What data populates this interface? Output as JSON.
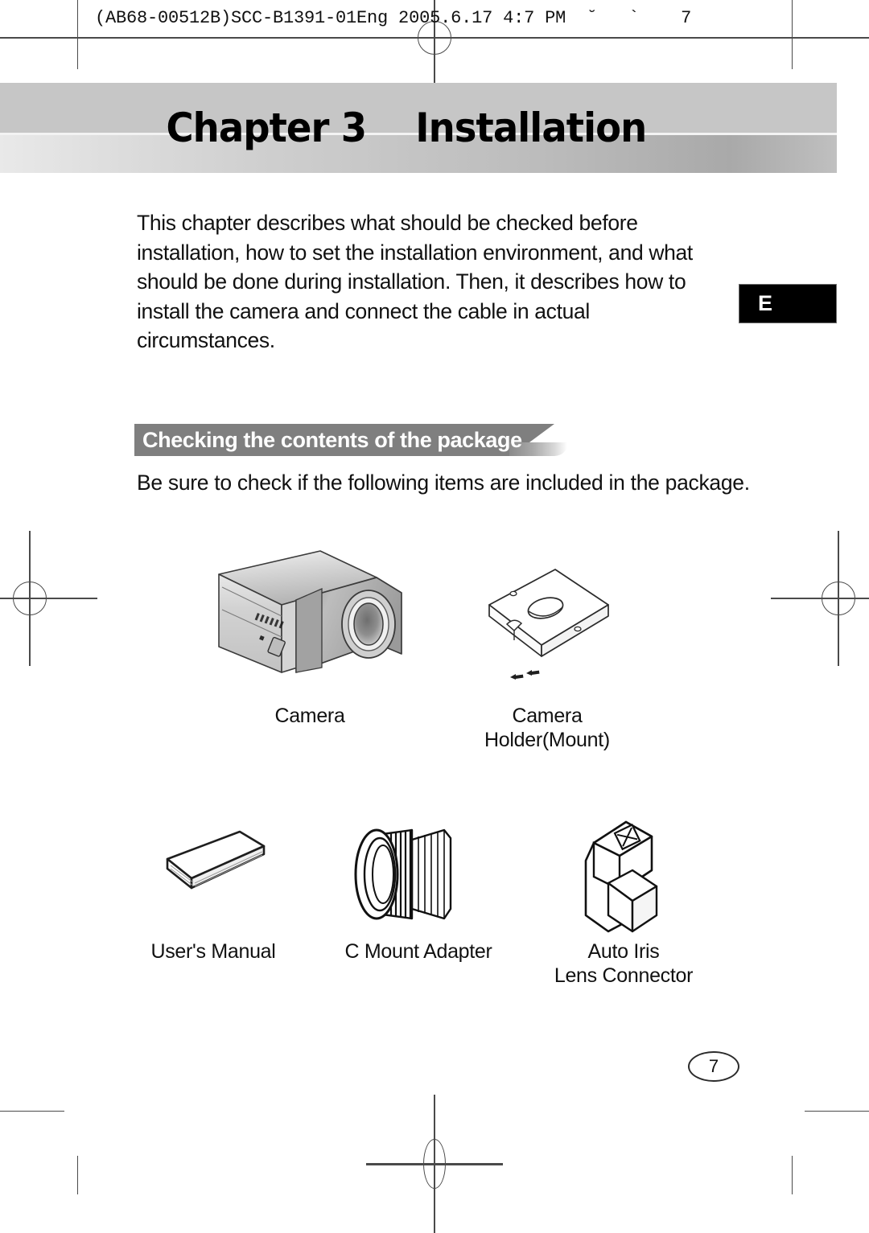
{
  "print_header": {
    "text": "(AB68-00512B)SCC-B1391-01Eng 2005.6.17 4:7 PM  ˘   `    7"
  },
  "chapter": {
    "banner_text": "Chapter 3    Installation",
    "number": "3",
    "title": "Installation"
  },
  "intro": {
    "paragraph": "This chapter describes what should be checked before installation, how to set the installation environment, and what should be done during installation. Then, it describes how to install the camera and connect the cable in actual circumstances."
  },
  "language_tab": {
    "letter": "E"
  },
  "section": {
    "heading": "Checking the contents of the package",
    "sub_text": "Be sure to check if the following items are included in the package."
  },
  "package_items": [
    {
      "id": "camera",
      "label": "Camera",
      "icon": "camera-illustration"
    },
    {
      "id": "camera-holder",
      "label": "Camera\nHolder(Mount)",
      "icon": "camera-holder-illustration"
    },
    {
      "id": "users-manual",
      "label": "User's Manual",
      "icon": "users-manual-illustration"
    },
    {
      "id": "c-mount-adapter",
      "label": "C Mount Adapter",
      "icon": "c-mount-adapter-illustration"
    },
    {
      "id": "auto-iris-lens-connector",
      "label": "Auto Iris\nLens Connector",
      "icon": "auto-iris-lens-connector-illustration"
    }
  ],
  "footer": {
    "page_number": "7"
  },
  "colors": {
    "banner_gray": "#c6c6c6",
    "section_bar_gray": "#7f7f7f",
    "text_black": "#111111",
    "tab_black": "#000000"
  }
}
